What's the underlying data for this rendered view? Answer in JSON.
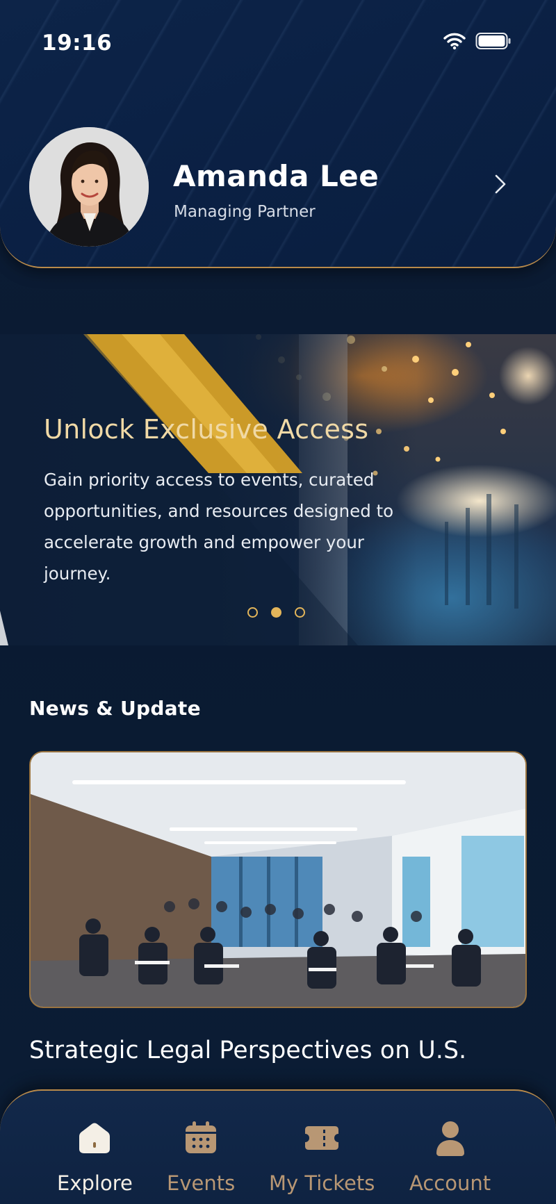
{
  "status_bar": {
    "time": "19:16",
    "icons": [
      "wifi-icon",
      "battery-icon"
    ]
  },
  "profile": {
    "name": "Amanda Lee",
    "role": "Managing Partner",
    "chevron_icon": "chevron-right-icon"
  },
  "banner": {
    "title": "Unlock Exclusive Access",
    "text": "Gain priority access to events, curated opportunities, and resources designed to accelerate growth and empower your journey.",
    "slides": 3,
    "active_slide": 2
  },
  "news": {
    "section_title": "News & Update",
    "items": [
      {
        "headline": "Strategic Legal Perspectives on U.S."
      }
    ]
  },
  "nav": {
    "items": [
      {
        "label": "Explore",
        "icon": "home-icon",
        "active": true
      },
      {
        "label": "Events",
        "icon": "calendar-icon",
        "active": false
      },
      {
        "label": "My Tickets",
        "icon": "ticket-icon",
        "active": false
      },
      {
        "label": "Account",
        "icon": "user-icon",
        "active": false
      }
    ]
  },
  "colors": {
    "background": "#0b1a30",
    "gold_accent": "#e3b55a",
    "banner_title": "#f0d9a6",
    "nav_inactive": "#b89774",
    "nav_active": "#f4efe6"
  }
}
